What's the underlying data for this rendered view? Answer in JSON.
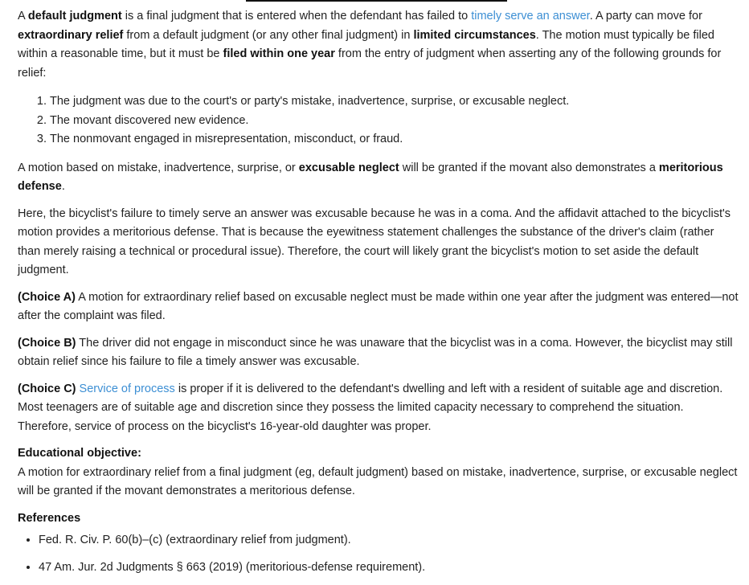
{
  "intro": {
    "t1": "A ",
    "b1": "default judgment",
    "t2": " is a final judgment that is entered when the defendant has failed to ",
    "link1": "timely serve an answer",
    "t3": ".  A party can move for ",
    "b2": "extraordinary relief",
    "t4": " from a default judgment (or any other final judgment) in ",
    "b3": "limited circumstances",
    "t5": ".  The motion must typically be filed within a reasonable time, but it must be ",
    "b4": "filed within one year",
    "t6": " from the entry of judgment when asserting any of the following grounds for relief:"
  },
  "grounds": [
    "The judgment was due to the court's or party's mistake, inadvertence, surprise, or excusable neglect.",
    "The movant discovered new evidence.",
    "The nonmovant engaged in misrepresentation, misconduct, or fraud."
  ],
  "rule": {
    "t1": "A motion based on mistake, inadvertence, surprise, or ",
    "b1": "excusable neglect",
    "t2": " will be granted if the movant also demonstrates a ",
    "b2": "meritorious defense",
    "t3": "."
  },
  "application": "Here, the bicyclist's failure to timely serve an answer was excusable because he was in a coma.  And the affidavit attached to the bicyclist's motion provides a meritorious defense.  That is because the eyewitness statement challenges the substance of the driver's claim (rather than merely raising a technical or procedural issue).  Therefore, the court will likely grant the bicyclist's motion to set aside the default judgment.",
  "choices": {
    "a": {
      "label": "(Choice A)",
      "text": " A motion for extraordinary relief based on excusable neglect must be made within one year after the judgment was entered—not after the complaint was filed."
    },
    "b": {
      "label": "(Choice B)",
      "text": " The driver did not engage in misconduct since he was unaware that the bicyclist was in a coma.  However, the bicyclist may still obtain relief since his failure to file a timely answer was excusable."
    },
    "c": {
      "label": "(Choice C)",
      "link": "Service of process",
      "text": " is proper if it is delivered to the defendant's dwelling and left with a resident of suitable age and discretion.  Most teenagers are of suitable age and discretion since they possess the limited capacity necessary to comprehend the situation.  Therefore, service of process on the bicyclist's 16-year-old daughter was proper."
    }
  },
  "objective": {
    "title": "Educational objective:",
    "text": "A motion for extraordinary relief from a final judgment (eg, default judgment) based on mistake, inadvertence, surprise, or excusable neglect will be granted if the movant demonstrates a meritorious defense."
  },
  "references": {
    "title": "References",
    "items": [
      "Fed. R. Civ. P. 60(b)–(c) (extraordinary relief from judgment).",
      "47 Am. Jur. 2d Judgments § 663 (2019) (meritorious-defense requirement)."
    ]
  },
  "colors": {
    "link": "#3d8fd4",
    "text": "#222222"
  }
}
